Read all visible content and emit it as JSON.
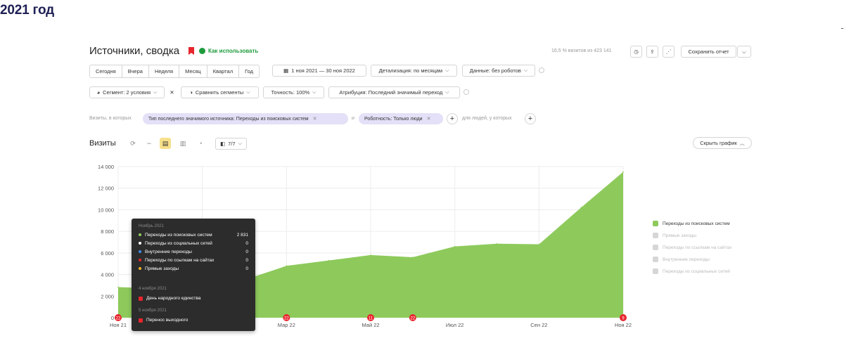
{
  "year_title": "2021 год",
  "report": {
    "title": "Источники, сводка",
    "how_to_use": "Как использовать",
    "visits_info": "16,5 % визитов из 423 141",
    "save_report": "Сохранить отчет"
  },
  "period_buttons": [
    "Сегодня",
    "Вчера",
    "Неделя",
    "Месяц",
    "Квартал",
    "Год"
  ],
  "date_range": "1 ноя 2021 — 30 ноя 2022",
  "detail": "Детализация: по месяцам",
  "data_mode": "Данные: без роботов",
  "segment": "Сегмент: 2 условия",
  "compare_segments": "Сравнить сегменты",
  "accuracy": "Точность: 100%",
  "attribution": "Атрибуция: Последний значимый переход",
  "filters": {
    "prefix": "Визиты, в которых",
    "pill_1": "Тип последнего значимого источника: Переходы из поисковых систем",
    "and": "и",
    "pill_2": "Роботность: Только люди",
    "suffix": "для людей, у которых"
  },
  "chart_header": {
    "title": "Визиты",
    "groups_label": "7/7",
    "hide_chart": "Скрыть график"
  },
  "chart_data": {
    "type": "area",
    "x": [
      "Ноя 21",
      "Дек 21",
      "Янв 22",
      "Фев 22",
      "Мар 22",
      "Апр 22",
      "Май 22",
      "Июн 22",
      "Июл 22",
      "Авг 22",
      "Сен 22",
      "Окт 22",
      "Ноя 22"
    ],
    "x_tick_labels": [
      "Ноя 21",
      "Мар 22",
      "Май 22",
      "Июл 22",
      "Сен 22",
      "Ноя 22"
    ],
    "y_ticks": [
      "0",
      "2 000",
      "4 000",
      "6 000",
      "8 000",
      "10 000",
      "12 000",
      "14 000"
    ],
    "ylim": [
      0,
      14000
    ],
    "grid": true,
    "series": [
      {
        "name": "Переходы из поисковых систем",
        "color": "#8dca5b",
        "values": [
          2831,
          2700,
          3000,
          3500,
          4800,
          5300,
          5800,
          5600,
          6600,
          6850,
          6800,
          10200,
          13500
        ]
      }
    ],
    "event_markers": [
      {
        "label": "22",
        "x_index": 0
      },
      {
        "label": "22",
        "x_index": 4
      },
      {
        "label": "11",
        "x_index": 6
      },
      {
        "label": "22",
        "x_index": 7
      },
      {
        "label": "9",
        "x_index": 12
      }
    ],
    "legend_position": "right",
    "legend": [
      {
        "name": "Переходы из поисковых систем",
        "active": true
      },
      {
        "name": "Прямые заходы",
        "active": false
      },
      {
        "name": "Переходы по ссылкам на сайтах",
        "active": false
      },
      {
        "name": "Внутренние переходы",
        "active": false
      },
      {
        "name": "Переходы из социальных сетей",
        "active": false
      }
    ]
  },
  "tooltip": {
    "header": "Ноябрь 2021",
    "rows": [
      {
        "label": "Переходы из поисковых систем",
        "value": "2 831",
        "color": "#8dca5b"
      },
      {
        "label": "Переходы из социальных сетей",
        "value": "0",
        "color": "#ffffff"
      },
      {
        "label": "Внутренние переходы",
        "value": "0",
        "color": "#3f8be8"
      },
      {
        "label": "Переходы по ссылкам на сайтах",
        "value": "0",
        "color": "#e8242c"
      },
      {
        "label": "Прямые заходы",
        "value": "0",
        "color": "#f0b429"
      }
    ],
    "holidays": [
      {
        "date": "4 ноября 2021",
        "name": "День народного единства"
      },
      {
        "date": "5 ноября 2021",
        "name": "Перенос выходного"
      }
    ]
  }
}
